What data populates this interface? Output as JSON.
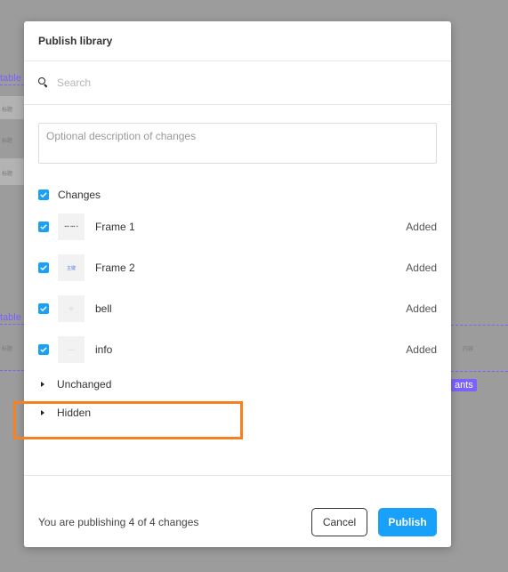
{
  "background": {
    "label_top": "table",
    "label_mid": "table",
    "badge": "ants",
    "cell_text": "标题",
    "cell_text_right": "内容"
  },
  "modal": {
    "title": "Publish library",
    "search": {
      "placeholder": "Search",
      "value": ""
    },
    "description": {
      "placeholder": "Optional description of changes",
      "value": ""
    },
    "changes": {
      "label": "Changes",
      "checked": true,
      "items": [
        {
          "name": "Frame 1",
          "status": "Added",
          "checked": true,
          "thumb_text": "▪▪▪ ▪▪▪ ▪"
        },
        {
          "name": "Frame 2",
          "status": "Added",
          "checked": true,
          "thumb_text": "主键"
        },
        {
          "name": "bell",
          "status": "Added",
          "checked": true,
          "thumb_text": ""
        },
        {
          "name": "info",
          "status": "Added",
          "checked": true,
          "thumb_text": ""
        }
      ]
    },
    "unchanged": {
      "label": "Unchanged"
    },
    "hidden": {
      "label": "Hidden"
    },
    "footer": {
      "summary": "You are publishing 4 of 4 changes",
      "cancel_label": "Cancel",
      "publish_label": "Publish"
    }
  },
  "colors": {
    "accent": "#18a0fb",
    "highlight": "#f58220",
    "canvas_guide": "#7b61ff"
  }
}
